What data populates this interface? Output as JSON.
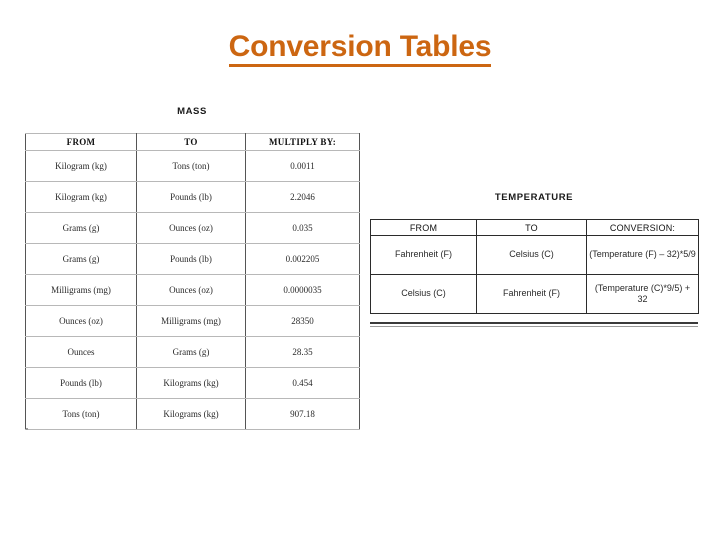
{
  "slide": {
    "title": "Conversion Tables",
    "title_color": "#CC6611",
    "background": "#FFFFFF"
  },
  "mass": {
    "caption": "MASS",
    "columns": [
      "FROM",
      "TO",
      "MULTIPLY BY:"
    ],
    "rows": [
      {
        "from": "Kilogram (kg)",
        "to": "Tons (ton)",
        "factor": "0.0011"
      },
      {
        "from": "Kilogram (kg)",
        "to": "Pounds (lb)",
        "factor": "2.2046"
      },
      {
        "from": "Grams (g)",
        "to": "Ounces (oz)",
        "factor": "0.035"
      },
      {
        "from": "Grams (g)",
        "to": "Pounds (lb)",
        "factor": "0.002205"
      },
      {
        "from": "Milligrams (mg)",
        "to": "Ounces (oz)",
        "factor": "0.0000035"
      },
      {
        "from": "Ounces (oz)",
        "to": "Milligrams (mg)",
        "factor": "28350"
      },
      {
        "from": "Ounces",
        "to": "Grams (g)",
        "factor": "28.35"
      },
      {
        "from": "Pounds (lb)",
        "to": "Kilograms (kg)",
        "factor": "0.454"
      },
      {
        "from": "Tons (ton)",
        "to": "Kilograms (kg)",
        "factor": "907.18"
      }
    ]
  },
  "temperature": {
    "caption": "TEMPERATURE",
    "columns": [
      "FROM",
      "TO",
      "CONVERSION:"
    ],
    "rows": [
      {
        "from": "Fahrenheit (F)",
        "to": "Celsius (C)",
        "conversion": "(Temperature (F) – 32)*5/9"
      },
      {
        "from": "Celsius (C)",
        "to": "Fahrenheit (F)",
        "conversion": "(Temperature (C)*9/5) + 32"
      }
    ]
  }
}
